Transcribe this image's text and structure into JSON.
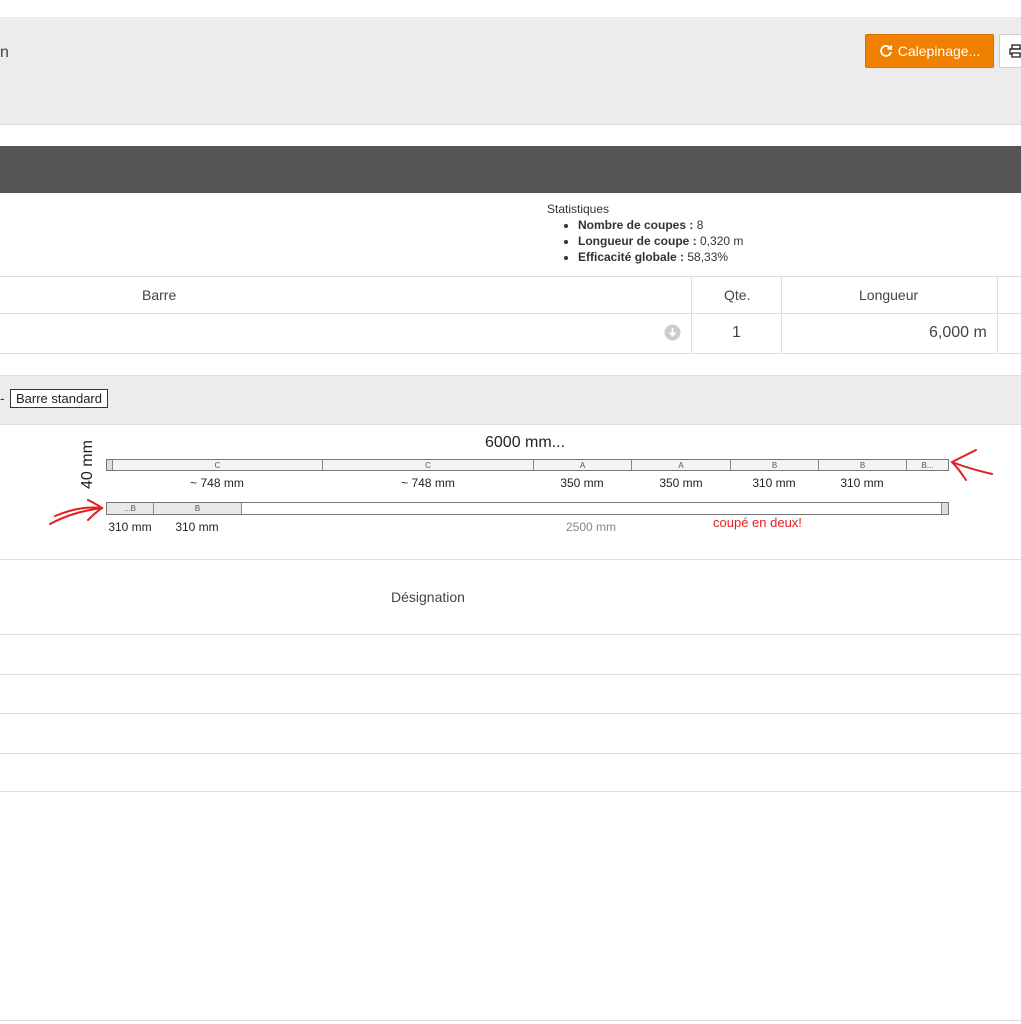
{
  "header": {
    "title_fragment": "n",
    "calepinage_label": "Calepinage...",
    "refresh_icon": "refresh-icon",
    "print_icon": "print-icon"
  },
  "stats": {
    "title": "Statistiques",
    "items": [
      {
        "label": "Nombre de coupes :",
        "value": " 8"
      },
      {
        "label": "Longueur de coupe :",
        "value": " 0,320 m"
      },
      {
        "label": "Efficacité globale :",
        "value": " 58,33%"
      }
    ]
  },
  "table": {
    "headers": [
      "Barre",
      "Qte.",
      "Longueur"
    ],
    "row": {
      "qte": "1",
      "longueur": "6,000 m"
    }
  },
  "section": {
    "dash": "-",
    "barre_label": "Barre standard"
  },
  "diagram": {
    "title": "6000 mm...",
    "height_label": "40 mm",
    "bar1_segments": [
      {
        "letter": "C",
        "label": "~ 748 mm"
      },
      {
        "letter": "C",
        "label": "~ 748 mm"
      },
      {
        "letter": "A",
        "label": "350 mm"
      },
      {
        "letter": "A",
        "label": "350 mm"
      },
      {
        "letter": "B",
        "label": "310 mm"
      },
      {
        "letter": "B",
        "label": "310 mm"
      },
      {
        "letter": "B...",
        "label": ""
      }
    ],
    "bar2_segments": [
      {
        "letter": "...B",
        "label": "310 mm"
      },
      {
        "letter": "B",
        "label": "310 mm"
      }
    ],
    "bar2_rest_label": "2500 mm",
    "annotation": "coupé en deux!"
  },
  "designation_header": "Désignation"
}
